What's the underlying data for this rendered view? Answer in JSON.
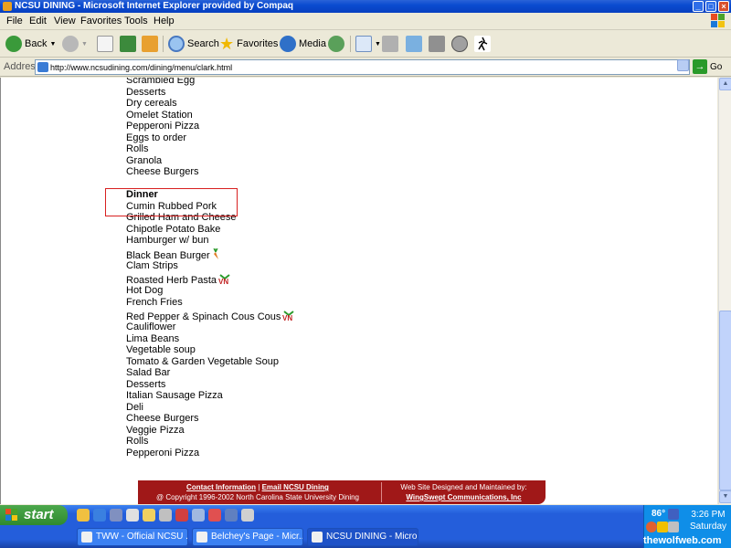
{
  "window": {
    "title": "NCSU DINING - Microsoft Internet Explorer provided by Compaq",
    "buttons": [
      "_",
      "□",
      "×"
    ]
  },
  "menubar": [
    "File",
    "Edit",
    "View",
    "Favorites",
    "Tools",
    "Help"
  ],
  "toolbar": {
    "back": "Back",
    "search": "Search",
    "favorites": "Favorites",
    "media": "Media"
  },
  "address": {
    "label": "Address",
    "url": "http://www.ncsudining.com/dining/menu/clark.html",
    "go": "Go"
  },
  "menu": {
    "items": [
      {
        "text": "Scrambled Egg"
      },
      {
        "text": "Desserts"
      },
      {
        "text": "Dry cereals"
      },
      {
        "text": "Omelet Station"
      },
      {
        "text": "Pepperoni Pizza"
      },
      {
        "text": "Eggs to order"
      },
      {
        "text": "Rolls"
      },
      {
        "text": "Granola"
      },
      {
        "text": "Cheese Burgers"
      },
      {
        "text": ""
      },
      {
        "text": "Dinner",
        "header": true
      },
      {
        "text": "Cumin Rubbed Pork"
      },
      {
        "text": "Grilled Ham and Cheese"
      },
      {
        "text": "Chipotle Potato Bake"
      },
      {
        "text": "Hamburger w/ bun"
      },
      {
        "text": "Black Bean Burger",
        "badge": "veg"
      },
      {
        "text": "Clam Strips"
      },
      {
        "text": "Roasted Herb Pasta",
        "badge": "vn"
      },
      {
        "text": "Hot Dog"
      },
      {
        "text": "French Fries"
      },
      {
        "text": "Red Pepper & Spinach Cous Cous",
        "badge": "vn"
      },
      {
        "text": "Cauliflower"
      },
      {
        "text": "Lima Beans"
      },
      {
        "text": "Vegetable soup"
      },
      {
        "text": "Tomato & Garden Vegetable Soup"
      },
      {
        "text": "Salad Bar"
      },
      {
        "text": "Desserts"
      },
      {
        "text": "Italian Sausage Pizza"
      },
      {
        "text": "Deli"
      },
      {
        "text": "Cheese Burgers"
      },
      {
        "text": "Veggie Pizza"
      },
      {
        "text": "Rolls"
      },
      {
        "text": "Pepperoni Pizza"
      }
    ]
  },
  "footer": {
    "contact": "Contact Information",
    "divider": "|",
    "email": "Email NCSU Dining",
    "copyright": "@ Copyright 1996-2002 North Carolina State University Dining",
    "designed": "Web Site Designed and Maintained by:",
    "designer": "WingSwept Communications, Inc"
  },
  "taskbar": {
    "start": "start",
    "tasks": [
      "TWW - Official NCSU ...",
      "Belchey's Page - Micr...",
      "NCSU DINING - Micro..."
    ],
    "temp": "86°",
    "time": "3:26 PM",
    "day": "Saturday",
    "watermark": "thewolfweb.com"
  },
  "colors": {
    "footer_bg": "#a01818",
    "highlight": "#d82020",
    "titlebar": "#0a4bd0"
  }
}
